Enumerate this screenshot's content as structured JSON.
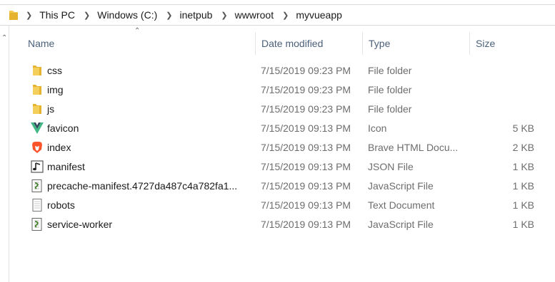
{
  "breadcrumb": [
    "This PC",
    "Windows (C:)",
    "inetpub",
    "wwwroot",
    "myvueapp"
  ],
  "columns": {
    "name": "Name",
    "date": "Date modified",
    "type": "Type",
    "size": "Size"
  },
  "files": [
    {
      "name": "css",
      "date": "7/15/2019 09:23 PM",
      "type": "File folder",
      "size": "",
      "icon": "folder-icon"
    },
    {
      "name": "img",
      "date": "7/15/2019 09:23 PM",
      "type": "File folder",
      "size": "",
      "icon": "folder-icon"
    },
    {
      "name": "js",
      "date": "7/15/2019 09:23 PM",
      "type": "File folder",
      "size": "",
      "icon": "folder-icon"
    },
    {
      "name": "favicon",
      "date": "7/15/2019 09:13 PM",
      "type": "Icon",
      "size": "5 KB",
      "icon": "vue-icon"
    },
    {
      "name": "index",
      "date": "7/15/2019 09:13 PM",
      "type": "Brave HTML Docu...",
      "size": "2 KB",
      "icon": "brave-icon"
    },
    {
      "name": "manifest",
      "date": "7/15/2019 09:13 PM",
      "type": "JSON File",
      "size": "1 KB",
      "icon": "music-note-icon"
    },
    {
      "name": "precache-manifest.4727da487c4a782fa1...",
      "date": "7/15/2019 09:13 PM",
      "type": "JavaScript File",
      "size": "1 KB",
      "icon": "script-icon"
    },
    {
      "name": "robots",
      "date": "7/15/2019 09:13 PM",
      "type": "Text Document",
      "size": "1 KB",
      "icon": "text-document-icon"
    },
    {
      "name": "service-worker",
      "date": "7/15/2019 09:13 PM",
      "type": "JavaScript File",
      "size": "1 KB",
      "icon": "script-icon"
    }
  ]
}
